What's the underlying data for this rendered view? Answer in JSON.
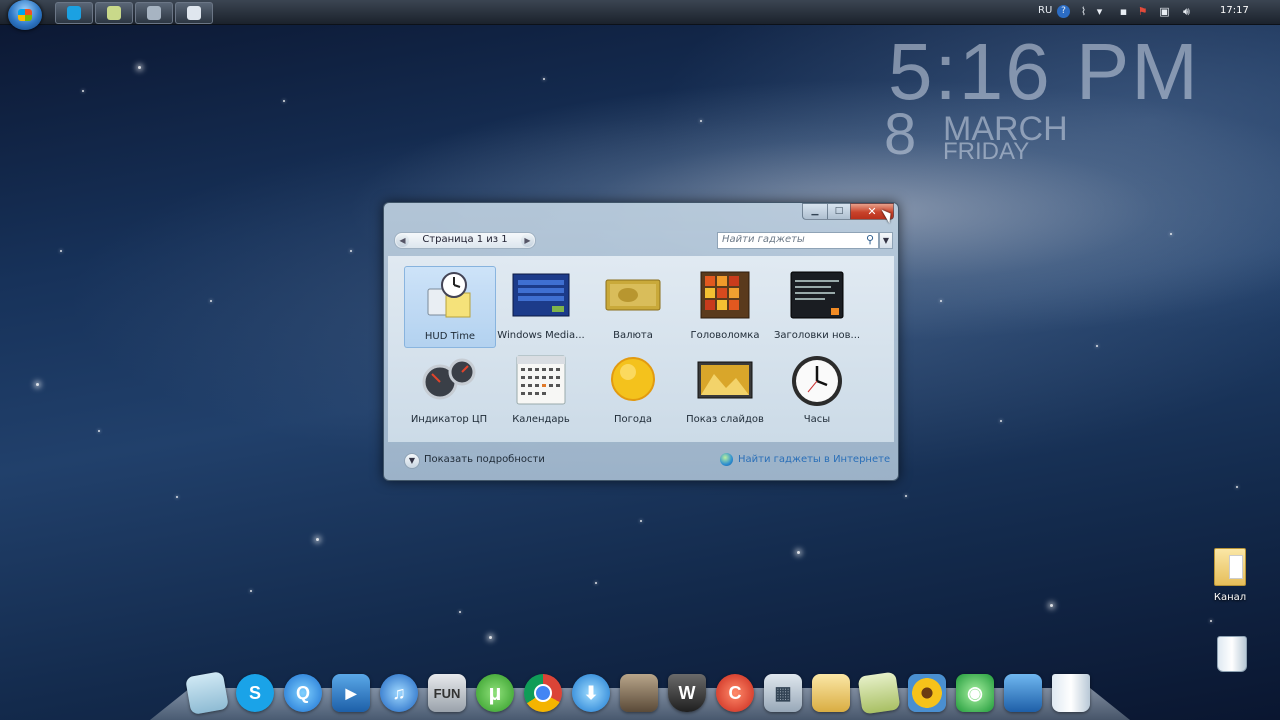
{
  "taskbar": {
    "tray": {
      "language": "RU",
      "clock": "17:17"
    }
  },
  "desktop_clock": {
    "time": "5:16 PM",
    "day": "8",
    "month": "MARCH",
    "weekday": "FRIDAY"
  },
  "gadget_window": {
    "close_glyph": "✕",
    "pager_label": "Страница 1 из 1",
    "search_placeholder": "Найти гаджеты",
    "gadgets": [
      {
        "name": "HUD Time",
        "icon": "clock-calendar-icon"
      },
      {
        "name": "Windows Media...",
        "icon": "media-center-icon"
      },
      {
        "name": "Валюта",
        "icon": "currency-icon"
      },
      {
        "name": "Головоломка",
        "icon": "puzzle-icon"
      },
      {
        "name": "Заголовки нов...",
        "icon": "news-headlines-icon"
      },
      {
        "name": "Индикатор ЦП",
        "icon": "cpu-meter-icon"
      },
      {
        "name": "Календарь",
        "icon": "calendar-icon"
      },
      {
        "name": "Погода",
        "icon": "weather-sun-icon"
      },
      {
        "name": "Показ слайдов",
        "icon": "slideshow-icon"
      },
      {
        "name": "Часы",
        "icon": "analog-clock-icon"
      }
    ],
    "details_label": "Показать подробности",
    "online_label": "Найти гаджеты в Интернете"
  },
  "desktop_icons": [
    {
      "label": "Канал",
      "icon": "folder-icon"
    },
    {
      "label": "",
      "icon": "recycle-bin-icon"
    }
  ],
  "dock": {
    "items": [
      {
        "icon": "notes-icon",
        "glyph": ""
      },
      {
        "icon": "skype-icon",
        "glyph": "S"
      },
      {
        "icon": "quicktime-icon",
        "glyph": "Q"
      },
      {
        "icon": "tv-icon",
        "glyph": "▶"
      },
      {
        "icon": "itunes-icon",
        "glyph": "♫"
      },
      {
        "icon": "fun-keyboard-icon",
        "glyph": "FUN"
      },
      {
        "icon": "utorrent-icon",
        "glyph": "µ"
      },
      {
        "icon": "chrome-icon",
        "glyph": ""
      },
      {
        "icon": "download-icon",
        "glyph": "⬇"
      },
      {
        "icon": "game-character-icon",
        "glyph": ""
      },
      {
        "icon": "world-of-tanks-icon",
        "glyph": "W"
      },
      {
        "icon": "ccleaner-icon",
        "glyph": "C"
      },
      {
        "icon": "calculator-icon",
        "glyph": "▦"
      },
      {
        "icon": "folder-icon",
        "glyph": ""
      },
      {
        "icon": "notepad-icon",
        "glyph": ""
      },
      {
        "icon": "sunflower-photos-icon",
        "glyph": ""
      },
      {
        "icon": "media-player-icon",
        "glyph": "◉"
      },
      {
        "icon": "computer-icon",
        "glyph": ""
      },
      {
        "icon": "trash-icon",
        "glyph": ""
      }
    ]
  }
}
